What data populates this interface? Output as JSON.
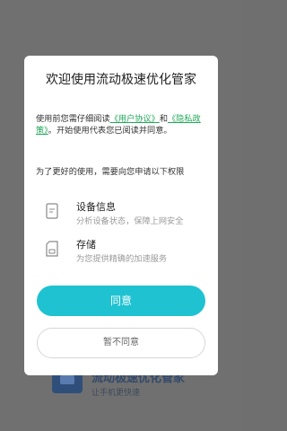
{
  "background_app": {
    "title": "流动极速优化管家",
    "subtitle": "让手机更快速"
  },
  "dialog": {
    "title": "欢迎使用流动极速优化管家",
    "intro_before": "使用前您需仔细阅读",
    "user_agreement_link": "《用户协议》",
    "and_text": "和",
    "privacy_link": "《隐私政策》",
    "intro_after": "。开始使用代表您已阅读并同意。",
    "permission_intro": "为了更好的使用，需要向您申请以下权限",
    "permissions": [
      {
        "name": "设备信息",
        "desc": "分析设备状态，保障上网安全",
        "icon": "device-info-icon"
      },
      {
        "name": "存储",
        "desc": "为您提供精确的加速服务",
        "icon": "storage-icon"
      }
    ],
    "agree_label": "同意",
    "decline_label": "暂不同意"
  },
  "colors": {
    "accent": "#1fc2d1",
    "link": "#22a85a",
    "overlay": "#707070"
  }
}
